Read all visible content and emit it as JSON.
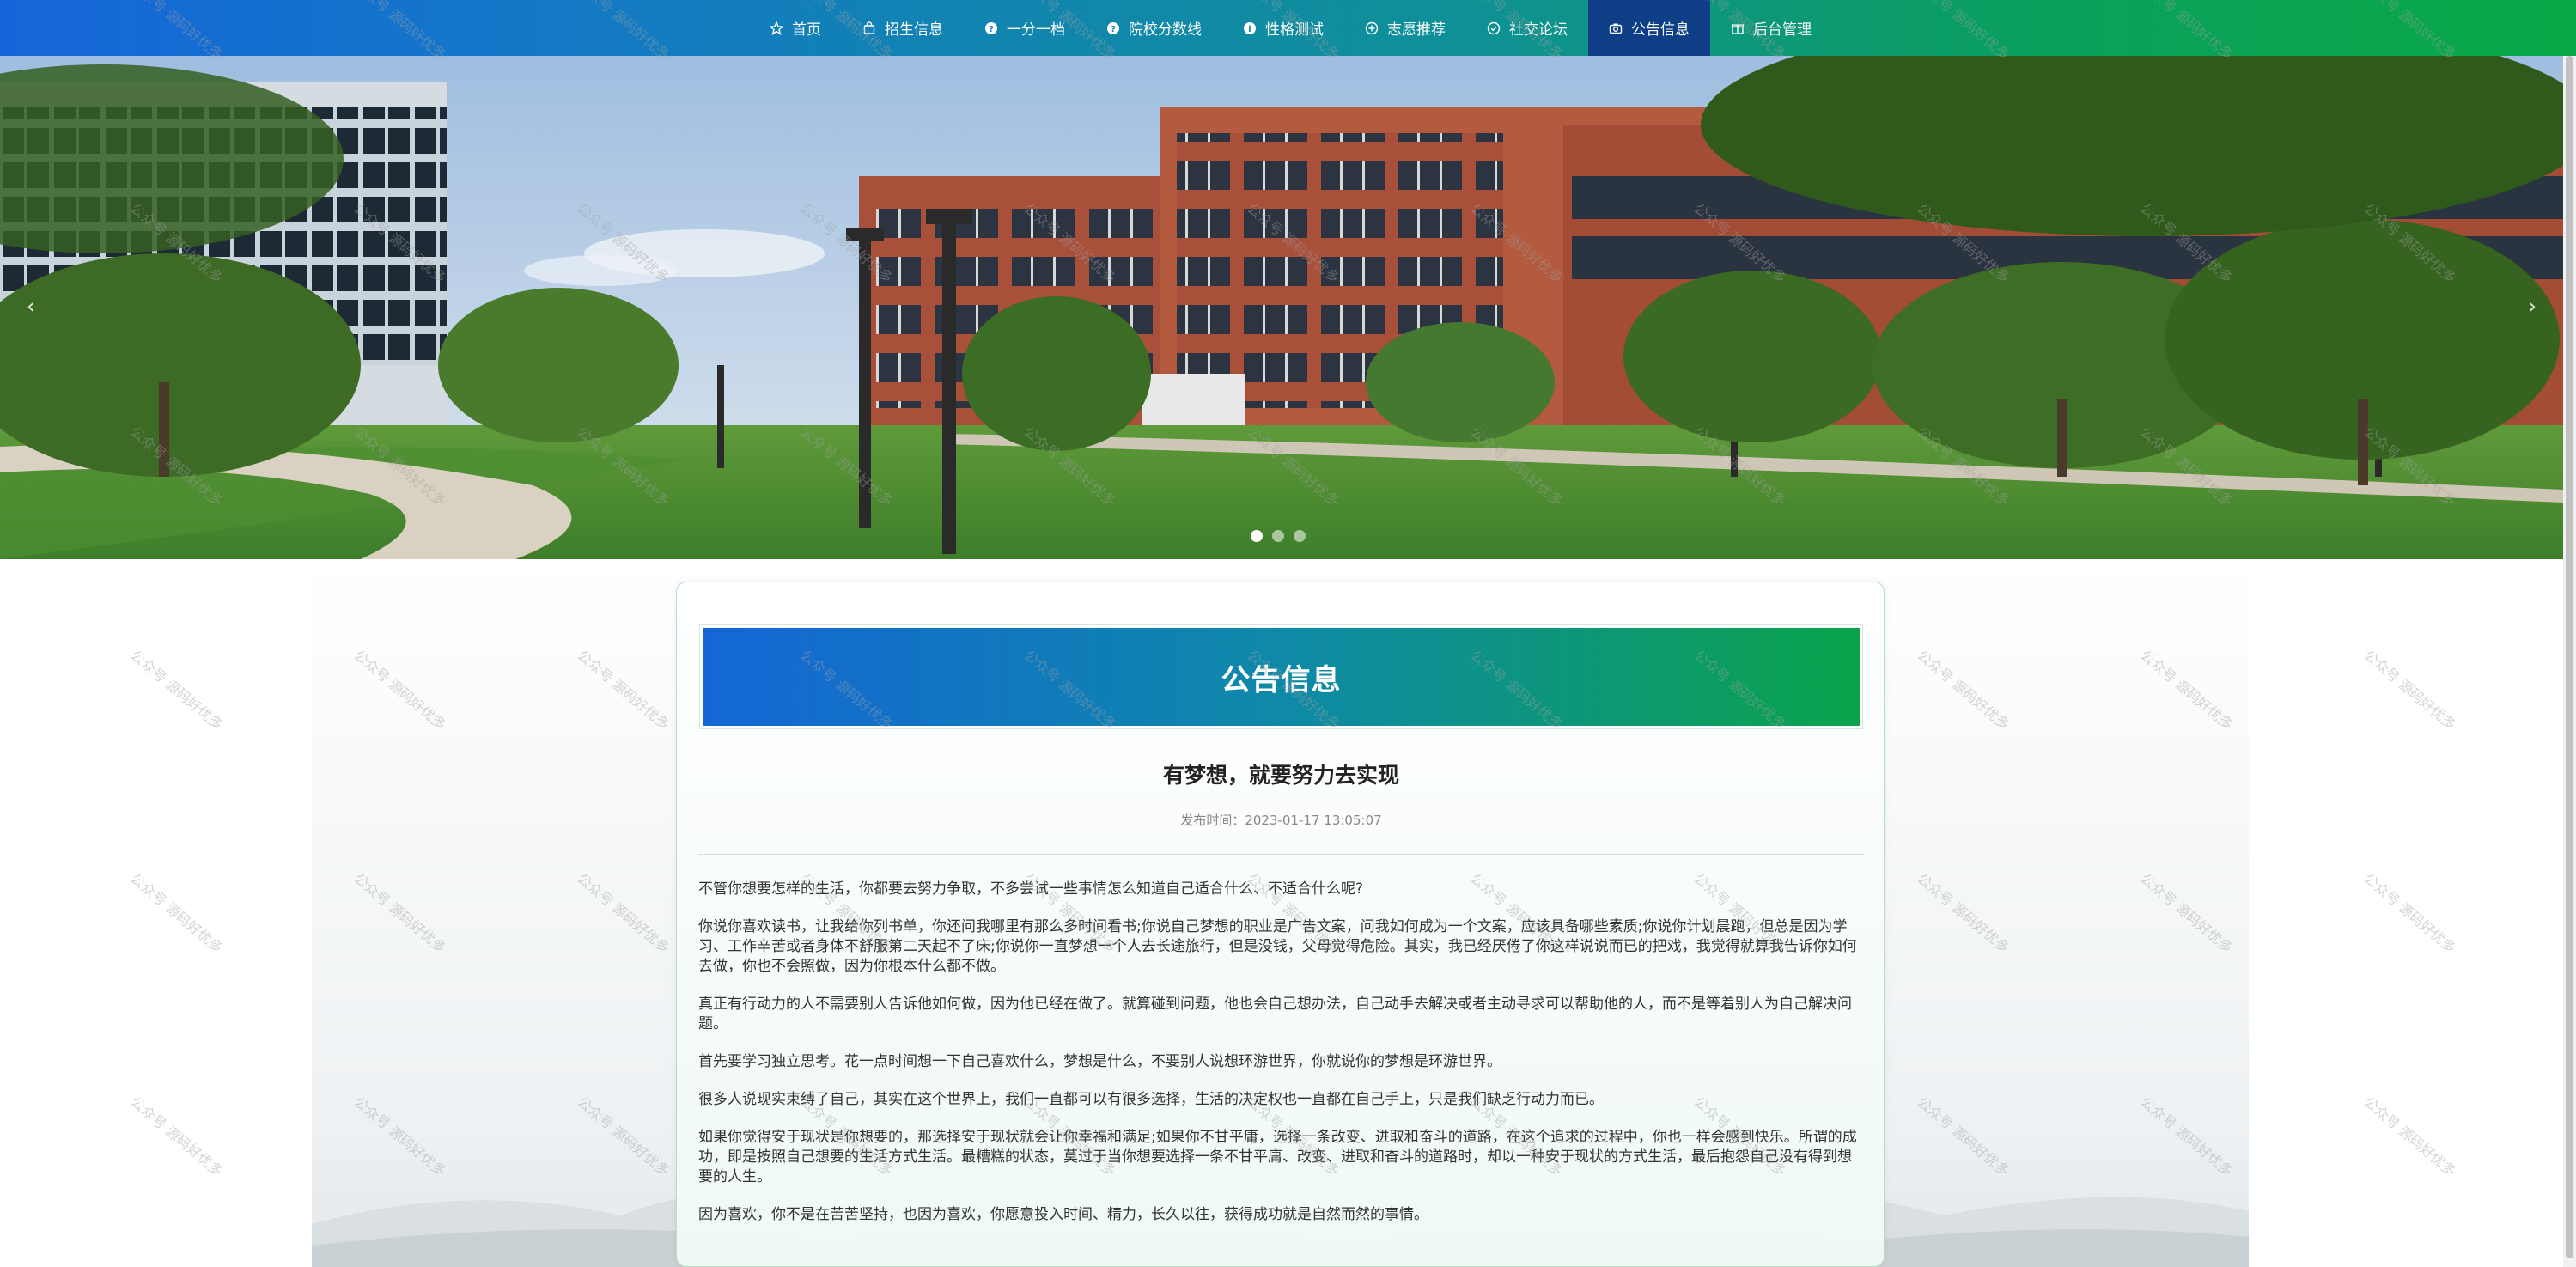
{
  "nav": {
    "items": [
      {
        "label": "首页",
        "icon": "star-icon"
      },
      {
        "label": "招生信息",
        "icon": "bag-icon"
      },
      {
        "label": "一分一档",
        "icon": "question-circle-icon"
      },
      {
        "label": "院校分数线",
        "icon": "question-circle-icon"
      },
      {
        "label": "性格测试",
        "icon": "info-circle-icon"
      },
      {
        "label": "志愿推荐",
        "icon": "plus-circle-icon"
      },
      {
        "label": "社交论坛",
        "icon": "check-circle-icon"
      },
      {
        "label": "公告信息",
        "icon": "camera-icon",
        "active": true
      },
      {
        "label": "后台管理",
        "icon": "gift-icon"
      }
    ]
  },
  "carousel": {
    "prev_label": "‹",
    "next_label": "›",
    "slide_count": 3,
    "active_index": 0
  },
  "page_header": {
    "title": "公告信息"
  },
  "article": {
    "title": "有梦想，就要努力去实现",
    "meta_label": "发布时间：",
    "publish_time": "2023-01-17 13:05:07",
    "paragraphs": [
      "不管你想要怎样的生活，你都要去努力争取，不多尝试一些事情怎么知道自己适合什么、不适合什么呢?",
      "你说你喜欢读书，让我给你列书单，你还问我哪里有那么多时间看书;你说自己梦想的职业是广告文案，问我如何成为一个文案，应该具备哪些素质;你说你计划晨跑，但总是因为学习、工作辛苦或者身体不舒服第二天起不了床;你说你一直梦想一个人去长途旅行，但是没钱，父母觉得危险。其实，我已经厌倦了你这样说说而已的把戏，我觉得就算我告诉你如何去做，你也不会照做，因为你根本什么都不做。",
      "真正有行动力的人不需要别人告诉他如何做，因为他已经在做了。就算碰到问题，他也会自己想办法，自己动手去解决或者主动寻求可以帮助他的人，而不是等着别人为自己解决问题。",
      "首先要学习独立思考。花一点时间想一下自己喜欢什么，梦想是什么，不要别人说想环游世界，你就说你的梦想是环游世界。",
      "很多人说现实束缚了自己，其实在这个世界上，我们一直都可以有很多选择，生活的决定权也一直都在自己手上，只是我们缺乏行动力而已。",
      "如果你觉得安于现状是你想要的，那选择安于现状就会让你幸福和满足;如果你不甘平庸，选择一条改变、进取和奋斗的道路，在这个追求的过程中，你也一样会感到快乐。所谓的成功，即是按照自己想要的生活方式生活。最糟糕的状态，莫过于当你想要选择一条不甘平庸、改变、进取和奋斗的道路时，却以一种安于现状的方式生活，最后抱怨自己没有得到想要的人生。",
      "因为喜欢，你不是在苦苦坚持，也因为喜欢，你愿意投入时间、精力，长久以往，获得成功就是自然而然的事情。"
    ]
  },
  "watermark_text": "公众号 源码好优多",
  "colors": {
    "nav_gradient_start": "#1565d8",
    "nav_gradient_end": "#09a846",
    "nav_active": "#0e3f86",
    "header_gradient_start": "#1466d6",
    "header_gradient_end": "#0aa34a"
  }
}
